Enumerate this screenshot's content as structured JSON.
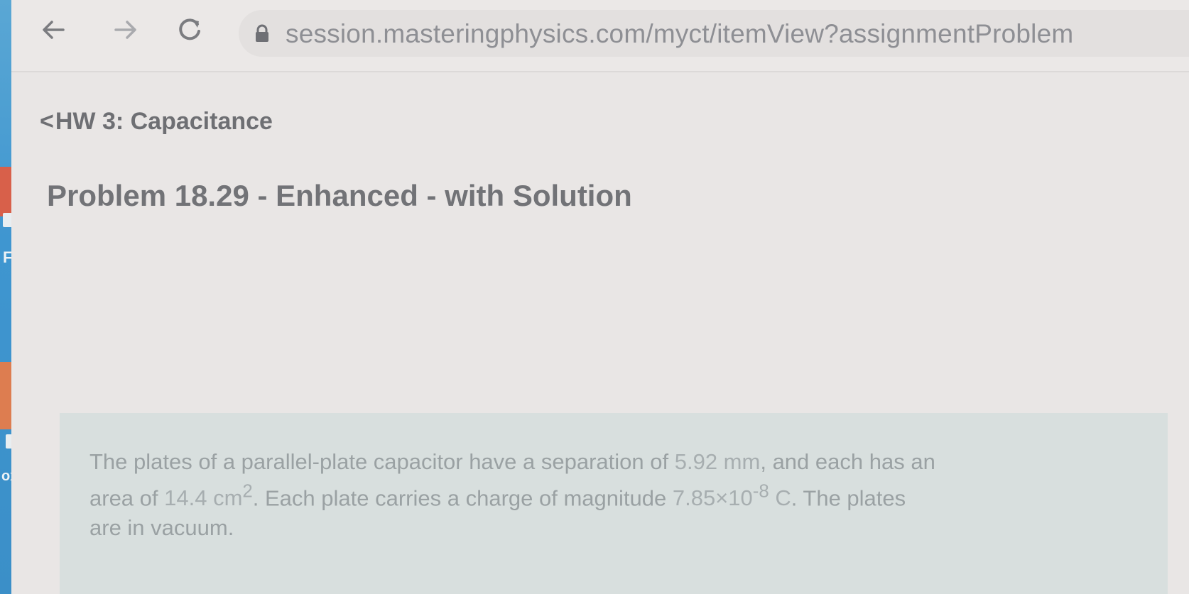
{
  "browser": {
    "url": "session.masteringphysics.com/myct/itemView?assignmentProblem",
    "back_icon": "arrow-left-icon",
    "forward_icon": "arrow-right-icon",
    "reload_icon": "reload-icon",
    "lock_icon": "lock-icon"
  },
  "desktop": {
    "side_text": "oxi",
    "side_letter": "F"
  },
  "breadcrumb": {
    "chevron": "<",
    "label": "HW 3: Capacitance"
  },
  "page": {
    "title": "Problem 18.29 - Enhanced - with Solution"
  },
  "problem": {
    "line1_a": "The plates of a parallel-plate capacitor have a separation of ",
    "separation": "5.92 mm",
    "line1_b": ", and each has an",
    "line2_a": "area of ",
    "area": "14.4 cm",
    "area_exp": "2",
    "line2_b": ". Each plate carries a charge of magnitude ",
    "charge": "7.85×10",
    "charge_exp": "-8",
    "charge_unit": " C",
    "line2_c": ". The plates",
    "line3": "are in vacuum."
  },
  "colors": {
    "page_bg": "#e6e3e2",
    "problem_box_bg": "#d8dfde",
    "title_text": "#727377",
    "url_text": "#8e8f94"
  }
}
